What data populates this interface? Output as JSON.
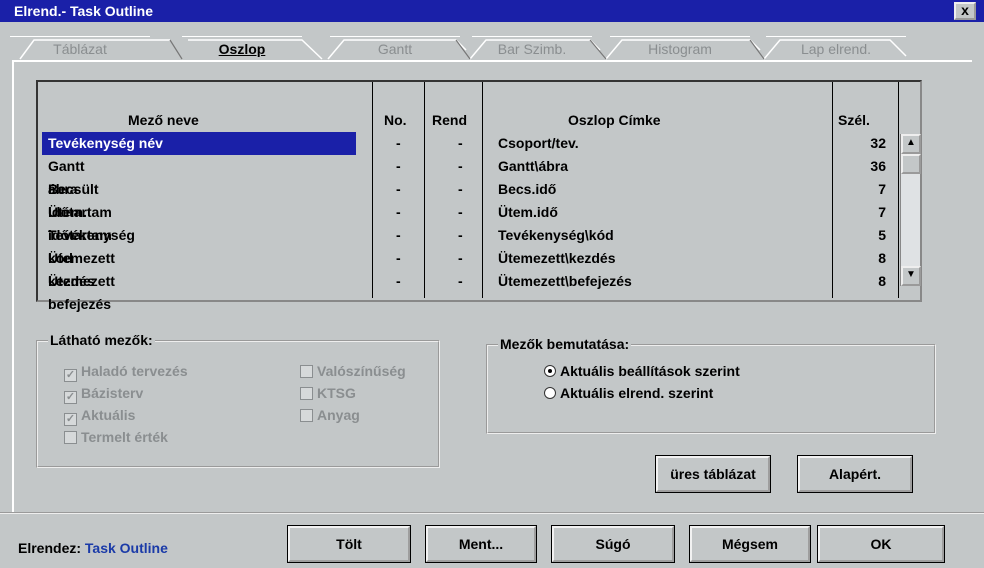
{
  "window": {
    "title": "Elrend.- Task Outline",
    "close_label": "x"
  },
  "tabs": [
    {
      "label": "Táblázat",
      "active": false
    },
    {
      "label": "Oszlop",
      "active": true
    },
    {
      "label": "Gantt",
      "active": false
    },
    {
      "label": "Bar Szimb.",
      "active": false
    },
    {
      "label": "Histogram",
      "active": false
    },
    {
      "label": "Lap elrend.",
      "active": false
    }
  ],
  "grid": {
    "headers": {
      "name": "Mező neve",
      "no": "No.",
      "rend": "Rend",
      "label": "Oszlop Címke",
      "width": "Szél."
    },
    "rows": [
      {
        "name": "Tevékenység név",
        "no": "-",
        "rend": "-",
        "label": "Csoport/tev.",
        "width": "32"
      },
      {
        "name": "Gantt ábra",
        "no": "-",
        "rend": "-",
        "label": "Gantt\\ábra",
        "width": "36"
      },
      {
        "name": "Becsült időtartam",
        "no": "-",
        "rend": "-",
        "label": "Becs.idő",
        "width": "7"
      },
      {
        "name": "Ütem. időtartam",
        "no": "-",
        "rend": "-",
        "label": "Ütem.idő",
        "width": "7"
      },
      {
        "name": "Tevékenység kód",
        "no": "-",
        "rend": "-",
        "label": "Tevékenység\\kód",
        "width": "5"
      },
      {
        "name": "Ütemezett kezdés",
        "no": "-",
        "rend": "-",
        "label": "Ütemezett\\kezdés",
        "width": "8"
      },
      {
        "name": "Ütemezett befejezés",
        "no": "-",
        "rend": "-",
        "label": "Ütemezett\\befejezés",
        "width": "8"
      }
    ],
    "selected_row": 0
  },
  "visible_fields": {
    "title": "Látható mezők:",
    "items": [
      {
        "label": "Haladó tervezés",
        "checked": true
      },
      {
        "label": "Bázisterv",
        "checked": true
      },
      {
        "label": "Aktuális",
        "checked": true
      },
      {
        "label": "Termelt érték",
        "checked": false
      },
      {
        "label": "Valószínűség",
        "checked": false
      },
      {
        "label": "KTSG",
        "checked": false
      },
      {
        "label": "Anyag",
        "checked": false
      }
    ]
  },
  "display": {
    "title": "Mezők bemutatása:",
    "options": [
      {
        "label": "Aktuális beállítások szerint",
        "selected": true
      },
      {
        "label": "Aktuális elrend. szerint",
        "selected": false
      }
    ]
  },
  "buttons": {
    "empty_table": "üres táblázat",
    "default": "Alapért.",
    "load": "Tölt",
    "save": "Ment...",
    "help": "Súgó",
    "cancel": "Mégsem",
    "ok": "OK"
  },
  "footer": {
    "label": "Elrendez:",
    "value": "Task Outline"
  },
  "colors": {
    "title_bar": "#1a20a8",
    "selection": "#1a20a8",
    "face": "#c3c7c8"
  }
}
